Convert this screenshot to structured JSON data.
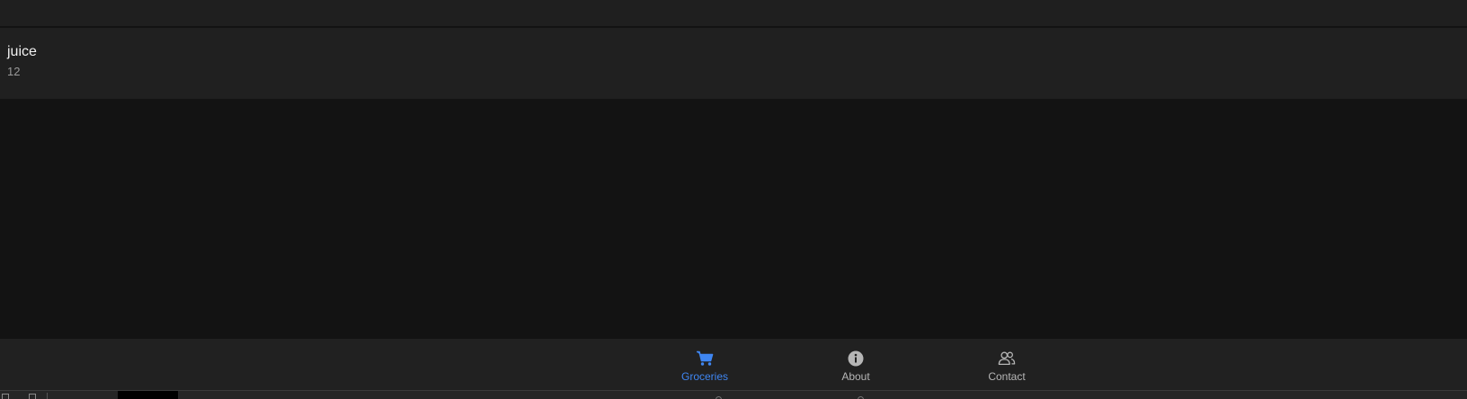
{
  "list": {
    "items": [
      {
        "name": "juice",
        "quantity": "12"
      }
    ]
  },
  "bottom_nav": {
    "items": [
      {
        "label": "Groceries",
        "icon": "cart-icon",
        "active": true
      },
      {
        "label": "About",
        "icon": "info-icon",
        "active": false
      },
      {
        "label": "Contact",
        "icon": "people-icon",
        "active": false
      }
    ]
  },
  "colors": {
    "background": "#131313",
    "surface": "#202020",
    "accent": "#3f86f2",
    "inactive": "#b6b6b6"
  }
}
